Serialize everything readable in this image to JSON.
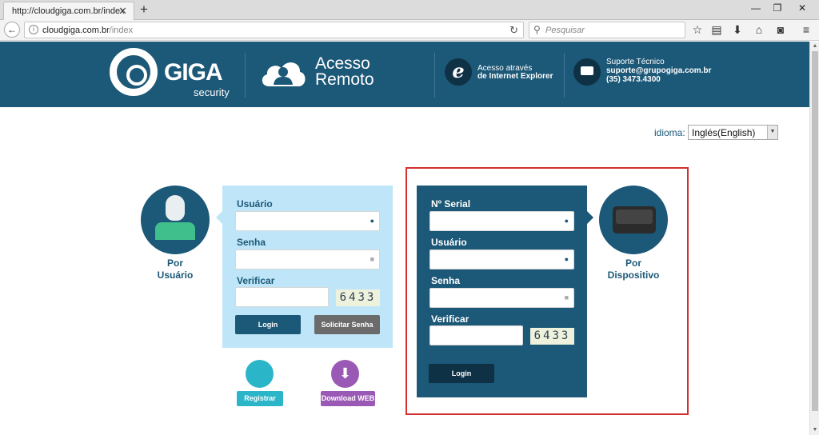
{
  "browser": {
    "tab_title": "http://cloudgiga.com.br/index",
    "url_host": "cloudgiga.com.br",
    "url_path": "/index",
    "search_placeholder": "Pesquisar"
  },
  "header": {
    "brand": "GIGA",
    "brand_sub": "security",
    "title_line1": "Acesso",
    "title_line2": "Remoto",
    "ie_line1": "Acesso através",
    "ie_line2": "de Internet Explorer",
    "support_title": "Suporte Técnico",
    "support_email": "suporte@grupogiga.com.br",
    "support_phone": "(35) 3473.4300"
  },
  "language": {
    "label": "idioma:",
    "selected": "Inglés(English)"
  },
  "user_login": {
    "caption_line1": "Por",
    "caption_line2": "Usuário",
    "user_label": "Usuário",
    "password_label": "Senha",
    "verify_label": "Verificar",
    "captcha": "6433",
    "login_button": "Login",
    "request_password_button": "Solicitar Senha",
    "register_button": "Registrar",
    "download_button": "Download WEB"
  },
  "device_login": {
    "caption_line1": "Por",
    "caption_line2": "Dispositivo",
    "serial_label": "Nº Serial",
    "user_label": "Usuário",
    "password_label": "Senha",
    "verify_label": "Verificar",
    "captcha": "6433",
    "login_button": "Login"
  },
  "colors": {
    "primary": "#1c5877",
    "light_panel": "#bfe6f8",
    "highlight_frame": "#d32f2f",
    "register": "#2bb5c9",
    "download": "#9b59b6"
  }
}
